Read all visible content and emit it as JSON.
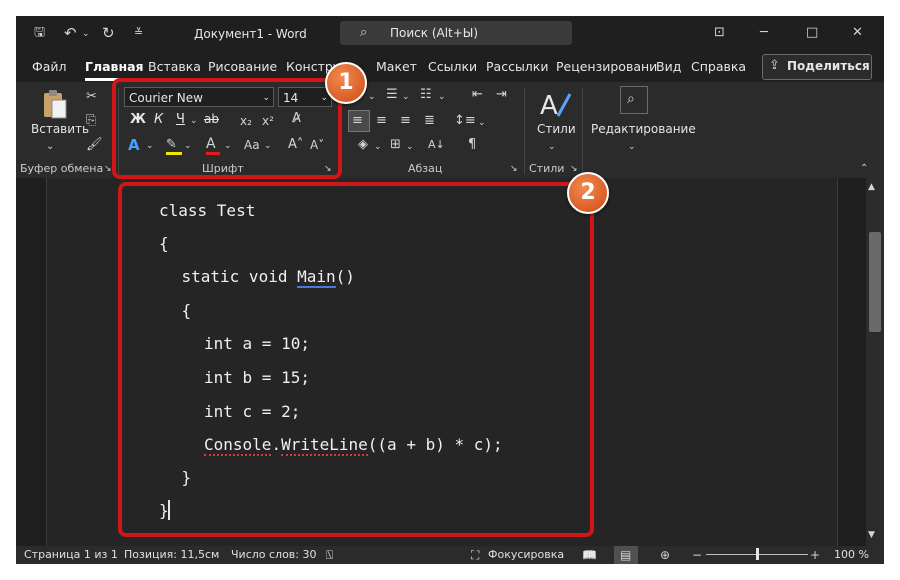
{
  "titlebar": {
    "doc_title": "Документ1  -  Word",
    "search_placeholder": "Поиск (Alt+Ы)"
  },
  "menu": {
    "items": [
      "Файл",
      "Главная",
      "Вставка",
      "Рисование",
      "Констру",
      "Макет",
      "Ссылки",
      "Рассылки",
      "Рецензировани",
      "Вид",
      "Справка"
    ],
    "active": "Главная",
    "share_label": "Поделиться"
  },
  "ribbon": {
    "clipboard": {
      "paste_label": "Вставить",
      "group_label": "Буфер обмена"
    },
    "font": {
      "font_name": "Courier New",
      "font_size": "14",
      "group_label": "Шрифт",
      "bold": "Ж",
      "italic": "К",
      "underline": "Ч",
      "strike": "ab"
    },
    "paragraph": {
      "group_label": "Абзац"
    },
    "styles": {
      "label": "Стили",
      "group_label": "Стили"
    },
    "editing": {
      "label": "Редактирование"
    }
  },
  "callouts": {
    "one": "1",
    "two": "2"
  },
  "document": {
    "lines": [
      {
        "indent": 0,
        "text": "class Test"
      },
      {
        "indent": 0,
        "text": "{"
      },
      {
        "indent": 1,
        "pre": "static void ",
        "link": "Main",
        "post": "()"
      },
      {
        "indent": 1,
        "text": "{"
      },
      {
        "indent": 2,
        "text": "int a = 10;"
      },
      {
        "indent": 2,
        "text": "int b = 15;"
      },
      {
        "indent": 2,
        "text": "int c = 2;"
      },
      {
        "indent": 2,
        "squig1": "Console",
        "mid": ".",
        "squig2": "WriteLine",
        "post": "((a + b) * c);"
      },
      {
        "indent": 1,
        "text": "}"
      },
      {
        "indent": 0,
        "text": "}"
      }
    ]
  },
  "status": {
    "page": "Страница 1 из 1",
    "position": "Позиция: 11,5см",
    "words": "Число слов: 30",
    "focus": "Фокусировка",
    "zoom": "100 %"
  },
  "colors": {
    "highlight_frame": "#d01616",
    "badge": "#e0602a"
  }
}
